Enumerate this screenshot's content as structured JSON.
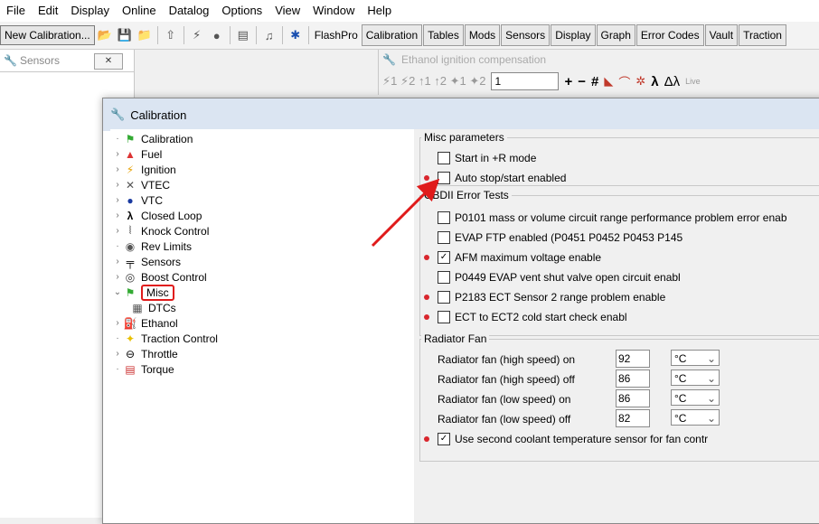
{
  "menu": [
    "File",
    "Edit",
    "Display",
    "Online",
    "Datalog",
    "Options",
    "View",
    "Window",
    "Help"
  ],
  "toolbar": {
    "new_calibration": "New Calibration...",
    "tabs": [
      "FlashPro",
      "Calibration",
      "Tables",
      "Mods",
      "Sensors",
      "Display",
      "Graph",
      "Error Codes",
      "Vault",
      "Traction"
    ]
  },
  "sensors_panel": {
    "title": "Sensors",
    "close_icon": "close-icon"
  },
  "ethanol_window": {
    "title": "Ethanol ignition compensation",
    "input_value": "1",
    "symbols": [
      "+",
      "−",
      "#",
      "λ",
      "Δλ",
      "Live"
    ]
  },
  "dialog": {
    "title": "Calibration",
    "tree": [
      {
        "label": "Calibration",
        "icon": "calibration-icon"
      },
      {
        "label": "Fuel",
        "icon": "fuel-icon"
      },
      {
        "label": "Ignition",
        "icon": "ignition-icon"
      },
      {
        "label": "VTEC",
        "icon": "vtec-icon"
      },
      {
        "label": "VTC",
        "icon": "vtc-icon"
      },
      {
        "label": "Closed Loop",
        "icon": "lambda-icon"
      },
      {
        "label": "Knock Control",
        "icon": "knock-icon"
      },
      {
        "label": "Rev Limits",
        "icon": "rev-limit-icon"
      },
      {
        "label": "Sensors",
        "icon": "sensor-icon"
      },
      {
        "label": "Boost Control",
        "icon": "boost-icon"
      },
      {
        "label": "Misc",
        "icon": "misc-icon"
      },
      {
        "label": "DTCs",
        "icon": "dtc-icon"
      },
      {
        "label": "Ethanol",
        "icon": "ethanol-icon"
      },
      {
        "label": "Traction Control",
        "icon": "traction-icon"
      },
      {
        "label": "Throttle",
        "icon": "throttle-icon"
      },
      {
        "label": "Torque",
        "icon": "torque-icon"
      }
    ],
    "misc": {
      "title": "Misc parameters",
      "start_r": "Start in +R mode",
      "auto_stop": "Auto stop/start enabled"
    },
    "obd": {
      "title": "OBDII Error Tests",
      "items": [
        {
          "label": "P0101 mass or volume circuit range performance problem error enab",
          "checked": false
        },
        {
          "label": "EVAP FTP enabled (P0451 P0452 P0453 P145",
          "checked": false
        },
        {
          "label": "AFM maximum voltage enable",
          "checked": true
        },
        {
          "label": "P0449 EVAP vent shut valve open circuit enabl",
          "checked": false
        },
        {
          "label": "P2183 ECT Sensor 2 range problem enable",
          "checked": false
        },
        {
          "label": "ECT to ECT2 cold start check enabl",
          "checked": false
        }
      ]
    },
    "radiator": {
      "title": "Radiator Fan",
      "rows": [
        {
          "label": "Radiator fan (high speed) on",
          "value": "92",
          "unit": "°C"
        },
        {
          "label": "Radiator fan (high speed) off",
          "value": "86",
          "unit": "°C"
        },
        {
          "label": "Radiator fan (low speed) on",
          "value": "86",
          "unit": "°C"
        },
        {
          "label": "Radiator fan (low speed) off",
          "value": "82",
          "unit": "°C"
        }
      ],
      "second_sensor": "Use second coolant temperature sensor for fan contr"
    }
  },
  "colors": {
    "accent_red": "#d9262d",
    "highlight_box": "#e01b1b"
  }
}
